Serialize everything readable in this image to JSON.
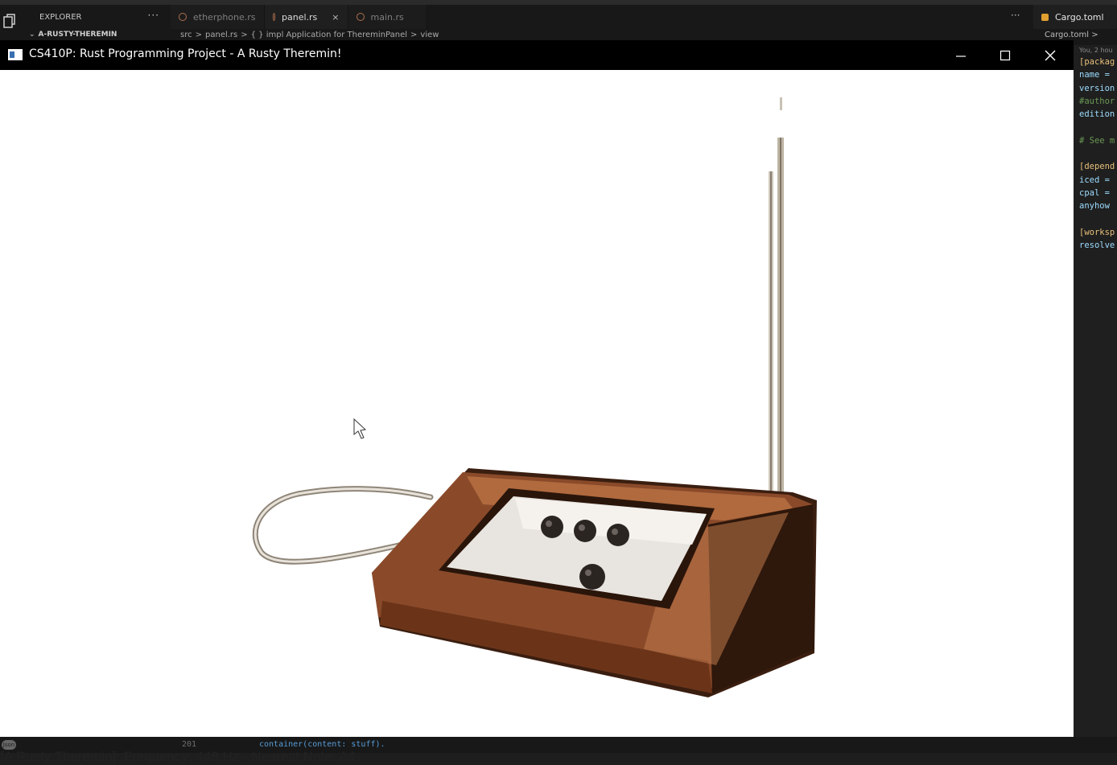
{
  "vscode": {
    "explorer_title": "EXPLORER",
    "explorer_more": "···",
    "folder": "A-RUSTY-THEREMIN",
    "tabs": [
      {
        "label": "etherphone.rs"
      },
      {
        "label": "panel.rs"
      },
      {
        "label": "main.rs"
      }
    ],
    "tab_close": "×",
    "tabs_more": "···",
    "breadcrumb": [
      "src",
      ">",
      "panel.rs",
      ">",
      "{ } impl Application for ThereminPanel",
      ">",
      "view"
    ],
    "right_tab_label": "Cargo.toml",
    "right_breadcrumb": "Cargo.toml >",
    "blame": "You, 2 hou",
    "cargo_lines": [
      {
        "text": "[packag",
        "color": "#e8c07a"
      },
      {
        "text": "name =",
        "color": "#9cdcfe"
      },
      {
        "text": "version",
        "color": "#9cdcfe"
      },
      {
        "text": "#author",
        "color": "#6a9955"
      },
      {
        "text": "edition",
        "color": "#9cdcfe"
      },
      {
        "text": "",
        "color": "#9cdcfe"
      },
      {
        "text": "# See m",
        "color": "#6a9955"
      },
      {
        "text": "",
        "color": "#9cdcfe"
      },
      {
        "text": "[depend",
        "color": "#e8c07a"
      },
      {
        "text": "iced =",
        "color": "#9cdcfe"
      },
      {
        "text": "cpal =",
        "color": "#9cdcfe"
      },
      {
        "text": "anyhow",
        "color": "#9cdcfe"
      },
      {
        "text": "",
        "color": "#9cdcfe"
      },
      {
        "text": "[worksp",
        "color": "#e8c07a"
      },
      {
        "text": "resolve",
        "color": "#9cdcfe"
      }
    ],
    "status_avatar": "Json",
    "status_line_number": "201",
    "status_code": "container(content: stuff)."
  },
  "app": {
    "title": "CS410P: Rust Programming Project - A Rusty Theremin!",
    "status_text": "[A Rusty Theremin]: Frequency: 448 Hz - Nearest Note: A4"
  },
  "colors": {
    "titlebar": "#000000",
    "canvas": "#ffffff",
    "wood": "#8a4a2a",
    "panel": "#e8e4df"
  }
}
